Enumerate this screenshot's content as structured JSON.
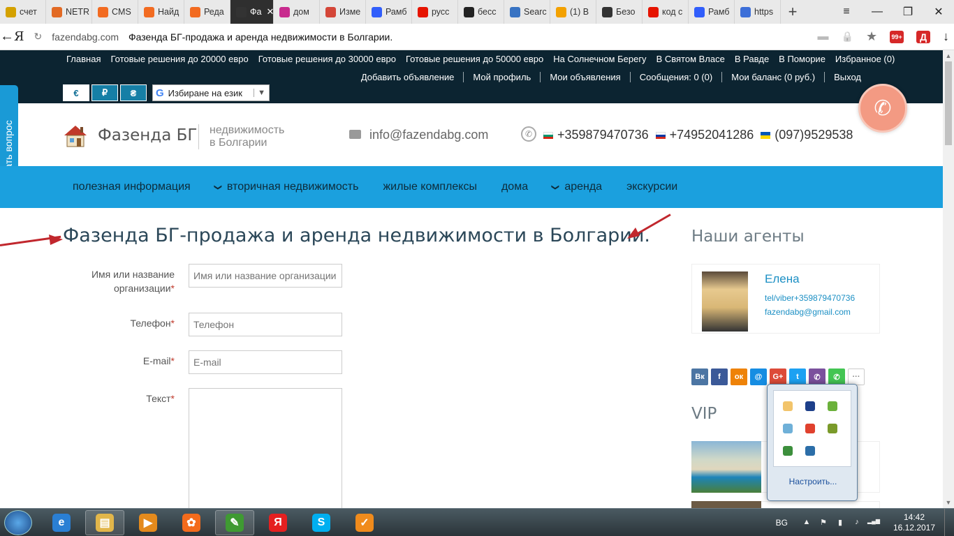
{
  "browser": {
    "tabs": [
      {
        "label": "счет",
        "favicon": "yandex-chart-icon",
        "color": "#d4a100"
      },
      {
        "label": "NETR",
        "favicon": "netr-icon",
        "color": "#e26a24"
      },
      {
        "label": "CMS",
        "favicon": "s-icon",
        "color": "#f26b21"
      },
      {
        "label": "Найд",
        "favicon": "s-icon",
        "color": "#f26b21"
      },
      {
        "label": "Реда",
        "favicon": "s-icon",
        "color": "#f26b21"
      },
      {
        "label": "Фа",
        "favicon": "home-icon",
        "color": "#333333",
        "active": true
      },
      {
        "label": "дом",
        "favicon": "two-icon",
        "color": "#c82b8e"
      },
      {
        "label": "Изме",
        "favicon": "gmail-icon",
        "color": "#d44638"
      },
      {
        "label": "Рамб",
        "favicon": "rambler-icon",
        "color": "#315efb"
      },
      {
        "label": "русс",
        "favicon": "yandex-icon",
        "color": "#e61400"
      },
      {
        "label": "бесс",
        "favicon": "face-icon",
        "color": "#222222"
      },
      {
        "label": "Searc",
        "favicon": "search-site-icon",
        "color": "#3873c3"
      },
      {
        "label": "(1) В",
        "favicon": "mail-at-icon",
        "color": "#f3a100"
      },
      {
        "label": "Безо",
        "favicon": "code-icon",
        "color": "#333333"
      },
      {
        "label": "код с",
        "favicon": "yandex-icon",
        "color": "#e61400"
      },
      {
        "label": "Рамб",
        "favicon": "rambler-icon",
        "color": "#315efb"
      },
      {
        "label": "https",
        "favicon": "generic-icon",
        "color": "#3d6fd8"
      }
    ],
    "active_tab_close": "✕",
    "new_tab": "+",
    "window_controls": {
      "menu": "≡",
      "minimize": "—",
      "restore": "❐",
      "close": "✕"
    },
    "address": {
      "back": "←",
      "brand": "Я",
      "reload": "↻",
      "domain": "fazendabg.com",
      "title": "Фазенда БГ-продажа и аренда недвижимости в Болгарии."
    },
    "addr_icons": {
      "comment": "▬",
      "lock": "🔒",
      "star": "★",
      "download": "↓"
    },
    "ext_badge": "99+",
    "ext_letter": "Д"
  },
  "site": {
    "top_links": [
      "Главная",
      "Готовые решения до 20000 евро",
      "Готовые решения до 30000 евро",
      "Готовые решения до 50000 евро",
      "На Солнечном Берегу",
      "В Святом Власе",
      "В Равде",
      "В Поморие",
      "Избранное (0)"
    ],
    "user_links": [
      "Добавить объявление",
      "Мой профиль",
      "Мои объявления",
      "Сообщения: 0 (0)",
      "Мои баланс (0 руб.)",
      "Выход"
    ],
    "currencies": [
      "€",
      "₽",
      "₴"
    ],
    "language_select": {
      "g": "G",
      "label": "Избиране на език",
      "arrow": "▼"
    },
    "brand": "Фазенда БГ",
    "tagline_1": "недвижимость",
    "tagline_2": "в Болгарии",
    "email": "info@fazendabg.com",
    "phones": [
      "+359879470736",
      "+74952041286",
      "(097)9529538"
    ],
    "phone_icon": "✆",
    "call_icon": "✆",
    "ask_tab": "Задать вопрос",
    "nav": [
      {
        "label": "полезная информация",
        "chev": ""
      },
      {
        "label": "вторичная недвижимость",
        "chev": "❯"
      },
      {
        "label": "жилые комплексы",
        "chev": ""
      },
      {
        "label": "дома",
        "chev": ""
      },
      {
        "label": "аренда",
        "chev": "❯"
      },
      {
        "label": "экскурсии",
        "chev": ""
      }
    ],
    "page_title": "Фазенда БГ-продажа и аренда недвижимости в Болгарии.",
    "form": {
      "name_label_1": "Имя или название",
      "name_label_2": "организации",
      "name_placeholder": "Имя или название организации",
      "phone_label": "Телефон",
      "phone_placeholder": "Телефон",
      "email_label": "E-mail",
      "email_placeholder": "E-mail",
      "text_label": "Текст",
      "required_mark": "*"
    },
    "agents_title": "Наши агенты",
    "agent": {
      "name": "Елена",
      "tel": "tel/viber+359879470736",
      "mail": "fazendabg@gmail.com"
    },
    "share": [
      {
        "label": "vk",
        "text": "Вк",
        "color": "#4c75a3"
      },
      {
        "label": "facebook",
        "text": "f",
        "color": "#3b5998"
      },
      {
        "label": "odnoklassniki",
        "text": "ок",
        "color": "#ee8208"
      },
      {
        "label": "moimir",
        "text": "@",
        "color": "#168de2"
      },
      {
        "label": "googleplus",
        "text": "G+",
        "color": "#dd4b39"
      },
      {
        "label": "twitter",
        "text": "t",
        "color": "#1da1f2"
      },
      {
        "label": "viber",
        "text": "✆",
        "color": "#7b519d"
      },
      {
        "label": "whatsapp",
        "text": "✆",
        "color": "#43c553"
      },
      {
        "label": "more",
        "text": "···",
        "color": "#ffffff"
      }
    ],
    "vip_title": "VIP"
  },
  "tray_popup": {
    "icons": [
      {
        "name": "tray-app-icon",
        "color": "#f2c46b"
      },
      {
        "name": "bluetooth-icon",
        "color": "#1d3f8a"
      },
      {
        "name": "evernote-icon",
        "color": "#6bb13b"
      },
      {
        "name": "network-tool-icon",
        "color": "#6fb0d8"
      },
      {
        "name": "flower-icon",
        "color": "#e0412e"
      },
      {
        "name": "winamp-icon",
        "color": "#7a9a2a"
      },
      {
        "name": "colors-app-icon",
        "color": "#3c8f3c"
      },
      {
        "name": "at-icon",
        "color": "#2c6ea8"
      }
    ],
    "configure": "Настроить..."
  },
  "taskbar": {
    "apps": [
      {
        "name": "ie-icon",
        "text": "e",
        "color": "#2a7fd4"
      },
      {
        "name": "explorer-icon",
        "text": "▤",
        "color": "#e2b64a"
      },
      {
        "name": "media-player-icon",
        "text": "▶",
        "color": "#e48a1c"
      },
      {
        "name": "share-app-icon",
        "text": "✿",
        "color": "#f36b1c"
      },
      {
        "name": "notepad-icon",
        "text": "✎",
        "color": "#3f9a32"
      },
      {
        "name": "yandex-browser-icon",
        "text": "Я",
        "color": "#e52020"
      },
      {
        "name": "skype-icon",
        "text": "S",
        "color": "#00aff0"
      },
      {
        "name": "todo-icon",
        "text": "✓",
        "color": "#f08b1c"
      }
    ],
    "lang": "BG",
    "tray_icons": [
      "▲",
      "⚑",
      "▮",
      "♪",
      "▂▄▆"
    ],
    "time": "14:42",
    "date": "16.12.2017"
  }
}
